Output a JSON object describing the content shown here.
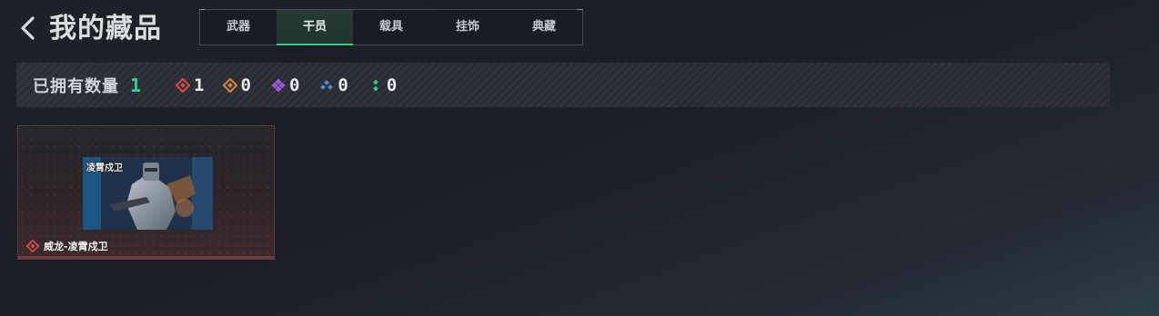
{
  "header": {
    "title": "我的藏品"
  },
  "tabs": [
    {
      "label": "武器",
      "active": false
    },
    {
      "label": "干员",
      "active": true
    },
    {
      "label": "载具",
      "active": false
    },
    {
      "label": "挂饰",
      "active": false
    },
    {
      "label": "典藏",
      "active": false
    }
  ],
  "stats": {
    "owned_label": "已拥有数量",
    "owned_count": "1",
    "rarities": [
      {
        "icon": "red-diamond-icon",
        "color": "#d94a4a",
        "count": "1"
      },
      {
        "icon": "orange-diamond-icon",
        "color": "#d9823a",
        "count": "0"
      },
      {
        "icon": "purple-diamond-icon",
        "color": "#9a5ad8",
        "count": "0"
      },
      {
        "icon": "blue-triangle-icon",
        "color": "#4a8fd8",
        "count": "0"
      },
      {
        "icon": "green-dots-icon",
        "color": "#2fc98a",
        "count": "0"
      }
    ]
  },
  "items": [
    {
      "name": "威龙-凌霄戍卫",
      "image_text": "凌霄戍卫",
      "rarity_icon": "red-diamond-icon",
      "rarity_color": "#d94a4a"
    }
  ],
  "colors": {
    "accent": "#34c98a",
    "background": "#1e2228"
  }
}
